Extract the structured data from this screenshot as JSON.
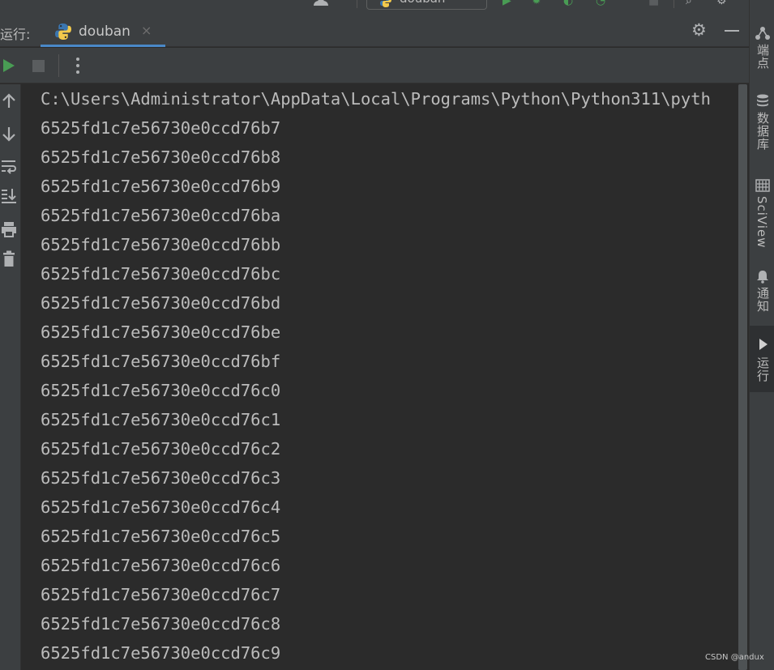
{
  "toolbar_top": {
    "run_config": "douban"
  },
  "run_window": {
    "title": "运行:",
    "tab_label": "douban",
    "tab_close": "×"
  },
  "console": {
    "lines": [
      "C:\\Users\\Administrator\\AppData\\Local\\Programs\\Python\\Python311\\pyth",
      "6525fd1c7e56730e0ccd76b7",
      "6525fd1c7e56730e0ccd76b8",
      "6525fd1c7e56730e0ccd76b9",
      "6525fd1c7e56730e0ccd76ba",
      "6525fd1c7e56730e0ccd76bb",
      "6525fd1c7e56730e0ccd76bc",
      "6525fd1c7e56730e0ccd76bd",
      "6525fd1c7e56730e0ccd76be",
      "6525fd1c7e56730e0ccd76bf",
      "6525fd1c7e56730e0ccd76c0",
      "6525fd1c7e56730e0ccd76c1",
      "6525fd1c7e56730e0ccd76c2",
      "6525fd1c7e56730e0ccd76c3",
      "6525fd1c7e56730e0ccd76c4",
      "6525fd1c7e56730e0ccd76c5",
      "6525fd1c7e56730e0ccd76c6",
      "6525fd1c7e56730e0ccd76c7",
      "6525fd1c7e56730e0ccd76c8",
      "6525fd1c7e56730e0ccd76c9"
    ]
  },
  "right_stripe": {
    "endpoints": "端点",
    "database": "数据库",
    "sciview": "SciView",
    "notifications": "通知",
    "run": "运行"
  },
  "icons": {
    "top": [
      "user-icon",
      "python-icon",
      "run-icon",
      "debug-icon",
      "coverage-icon",
      "profile-icon",
      "stop-icon",
      "search-icon",
      "settings-icon"
    ],
    "gutter": [
      "up-arrow-icon",
      "down-arrow-icon",
      "soft-wrap-icon",
      "scroll-to-end-icon",
      "print-icon",
      "trash-icon"
    ],
    "toolbar": [
      "rerun-icon",
      "stop-icon",
      "more-icon"
    ],
    "header": [
      "gear-icon",
      "minimize-icon"
    ],
    "stripe": [
      "endpoints-icon",
      "database-icon",
      "sciview-icon",
      "bell-icon",
      "run-icon"
    ]
  },
  "colors": {
    "background": "#2b2b2b",
    "panel": "#3c3f41",
    "text": "#bbbbbb",
    "accent": "#4a88c7",
    "run_green": "#499c54"
  },
  "watermark": "CSDN @andux"
}
